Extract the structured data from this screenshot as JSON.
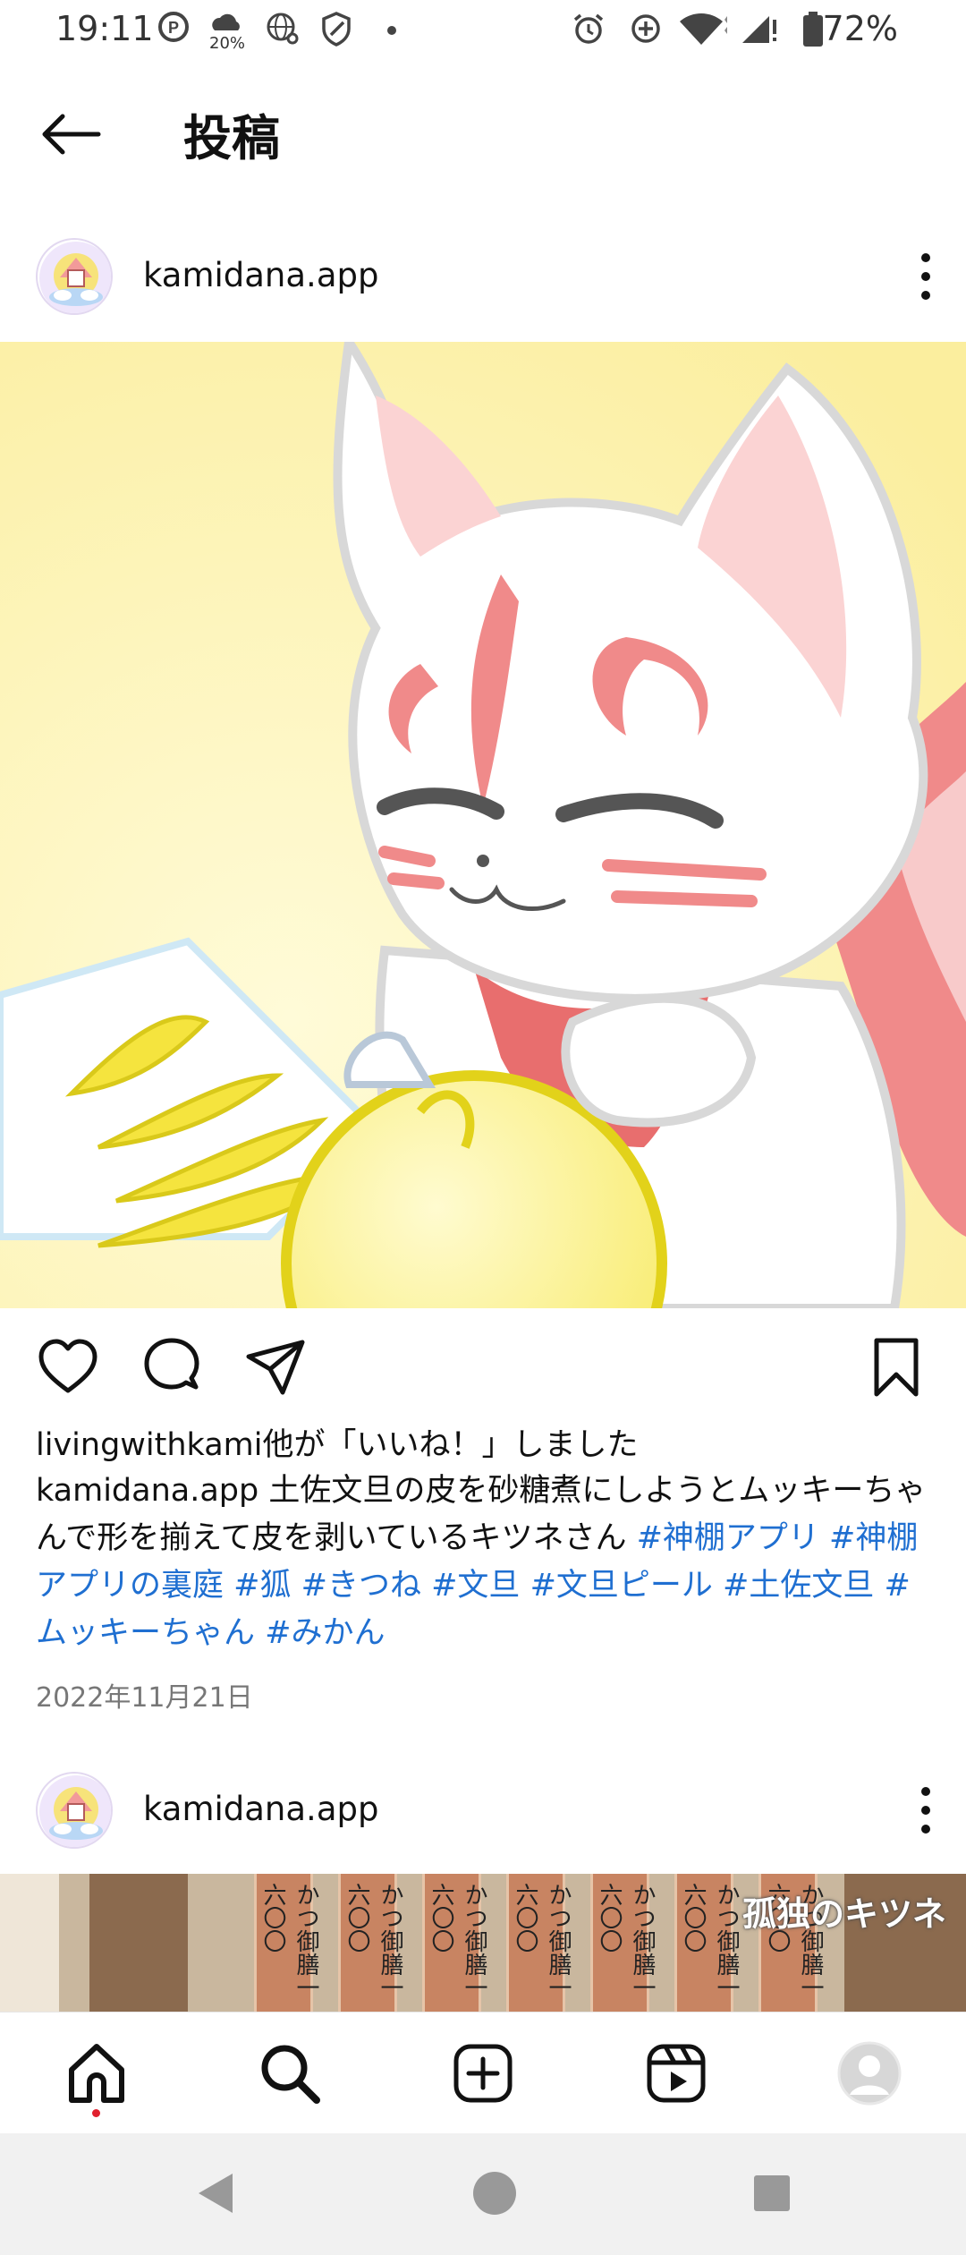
{
  "status_bar": {
    "time": "19:11",
    "battery_percent": "72%",
    "weather_percent": "20%",
    "left_icons": [
      "parking-icon",
      "weather-icon",
      "globe-icon",
      "shield-icon",
      "dot-icon"
    ],
    "right_icons": [
      "alarm-icon",
      "data-saver-icon",
      "wifi-icon",
      "signal-icon",
      "battery-icon"
    ]
  },
  "header": {
    "title": "投稿",
    "back_icon": "arrow-left-icon"
  },
  "posts": [
    {
      "username": "kamidana.app",
      "likes_text": "livingwithkami他が「いいね！」しました",
      "caption_user": "kamidana.app",
      "caption_text": " 土佐文旦の皮を砂糖煮にしようとムッキーちゃんで形を揃えて皮を剥いているキツネさん ",
      "hashtags": [
        "#神棚アプリ",
        "#神棚アプリの裏庭",
        "#狐",
        "#きつね",
        "#文旦",
        "#文旦ピール",
        "#土佐文旦",
        "#ムッキーちゃん",
        "#みかん"
      ],
      "date": "2022年11月21日"
    },
    {
      "username": "kamidana.app",
      "image_overlay_text": "孤独のキツネ",
      "slips": [
        "かつ御膳一六〇〇",
        "かつ御膳一六〇〇",
        "かつ御膳一六〇〇",
        "かつ御膳一六〇〇",
        "かつ御膳一六〇〇",
        "かつ御膳一六〇〇",
        "かつ御膳一六〇〇"
      ]
    }
  ],
  "actions": [
    "heart-icon",
    "comment-icon",
    "share-icon",
    "bookmark-icon"
  ],
  "bottom_nav": [
    "home-icon",
    "search-icon",
    "create-icon",
    "reels-icon",
    "profile-icon"
  ],
  "system_nav": [
    "back-triangle-icon",
    "home-circle-icon",
    "recents-square-icon"
  ],
  "colors": {
    "hashtag": "#1f6fd1",
    "image_background": "#fbf0a8",
    "fox_accent": "#f08a8a",
    "citrus": "#f2e34a"
  }
}
